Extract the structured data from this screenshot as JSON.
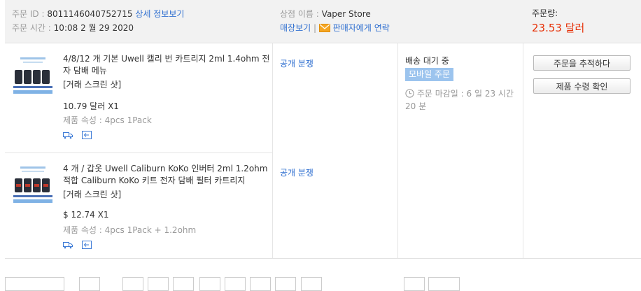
{
  "order": {
    "id_label": "주문 ID :",
    "id_value": "8011146040752715",
    "detail_link": "상세 정보보기",
    "time_label": "주문 시간 :",
    "time_value": "10:08 2 월 29 2020",
    "store_label": "상점 이름 :",
    "store_name": "Vaper Store",
    "store_view_link": "매장보기",
    "contact_seller_link": "판매자에게 연락",
    "amount_label": "주문량:",
    "amount_value": "23.53 달러",
    "status": "배송 대기 중",
    "mobile_badge": "모바일 주문",
    "deadline": "주문 마감일 : 6 일 23 시간 20 분",
    "track_button": "주문을 추적하다",
    "confirm_button": "제품 수령 확인"
  },
  "items": [
    {
      "title": "4/8/12 개 기본 Uwell 캘리 번 카트리지 2ml 1.4ohm 전자 담배 메뉴",
      "snapshot": "[거래 스크린 샷]",
      "price": "10.79 달러 X1",
      "attr": "제품 속성 : 4pcs 1Pack",
      "dispute": "공개 분쟁"
    },
    {
      "title": "4 개 / 갑옷 Uwell Caliburn KoKo 인버터 2ml 1.2ohm 적합 Caliburn KoKo 키트 전자 담배 필터 카트리지",
      "snapshot": "[거래 스크린 샷]",
      "price": "$ 12.74 X1",
      "attr": "제품 속성 : 4pcs 1Pack + 1.2ohm",
      "dispute": "공개 분쟁"
    }
  ],
  "colors": {
    "amount": "#e62e04",
    "link": "#2f6fd0",
    "badge": "#9cc4ee",
    "header_bg": "#f2f2f2"
  }
}
